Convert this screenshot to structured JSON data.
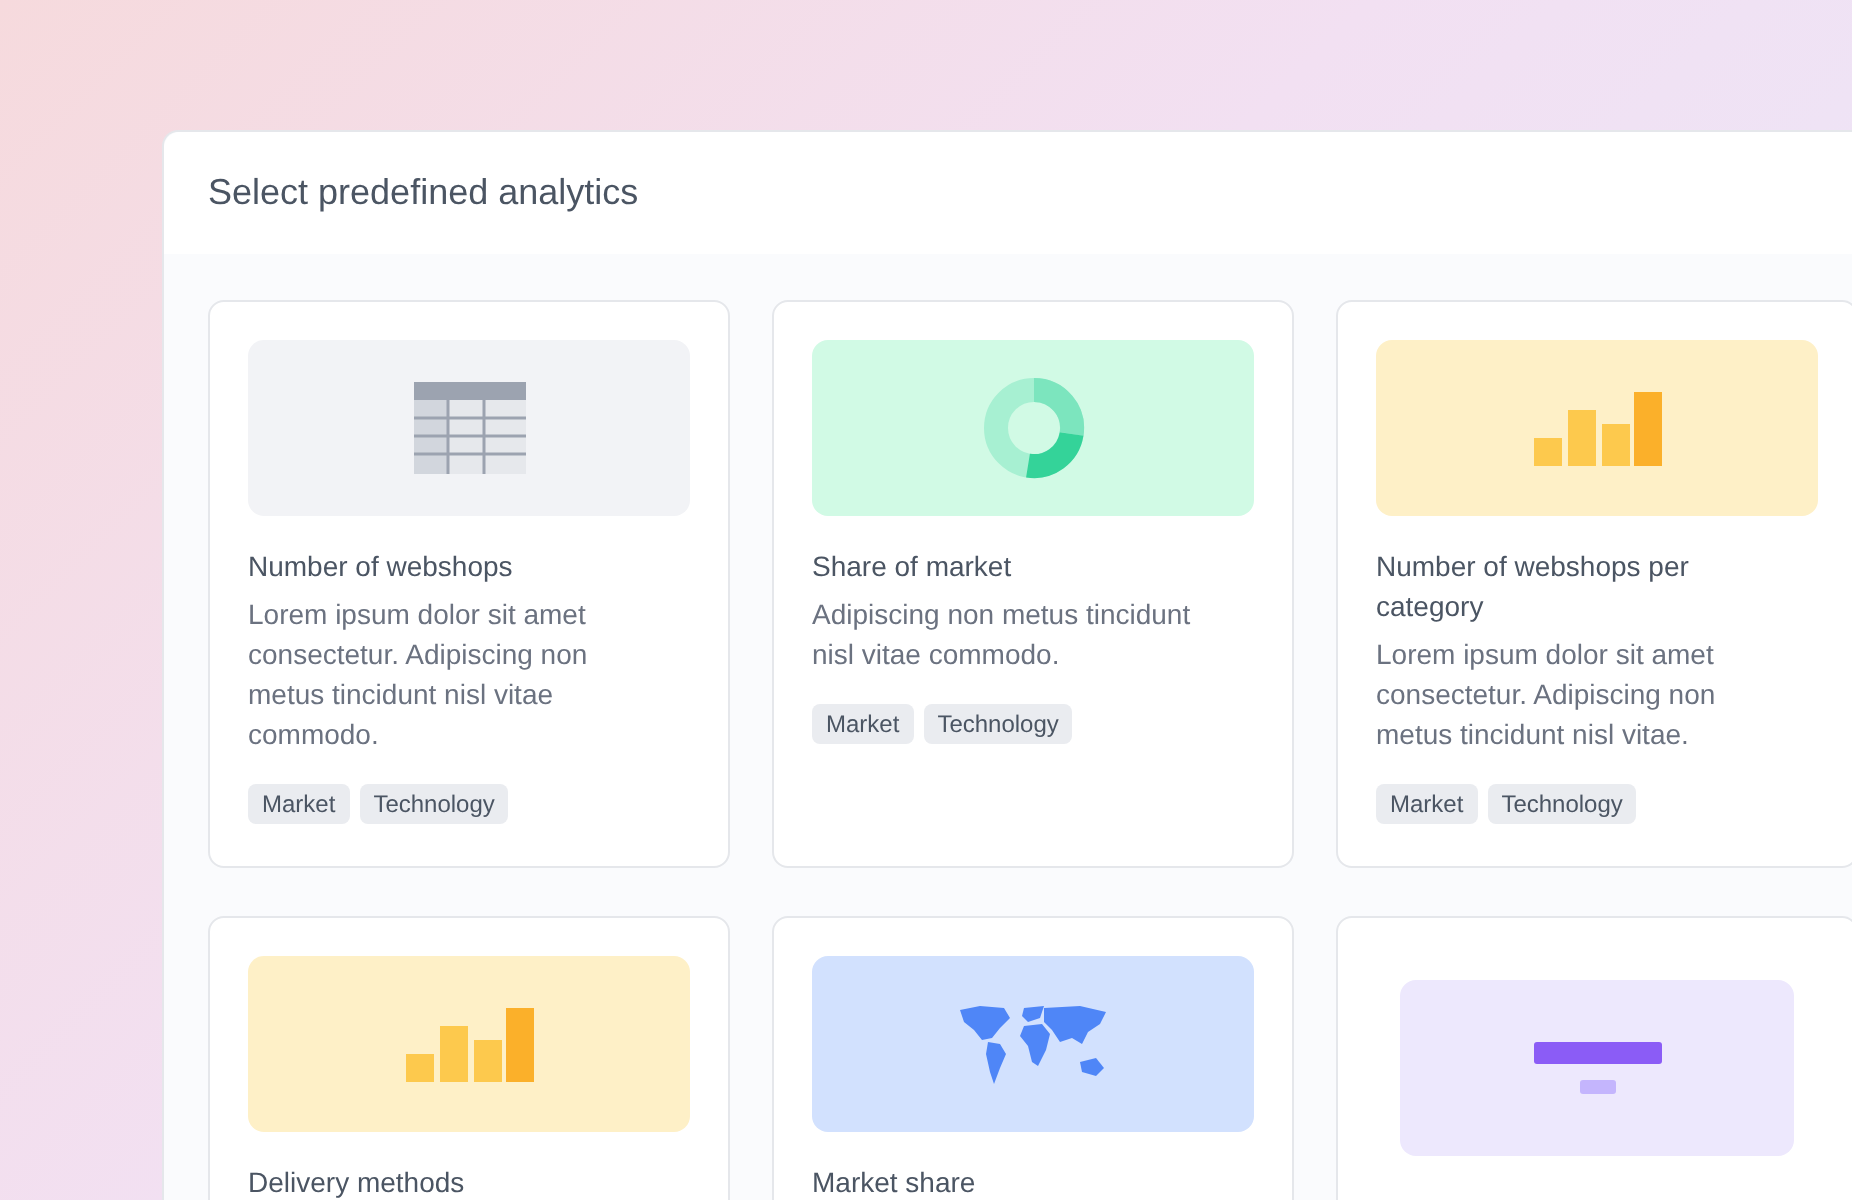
{
  "panel": {
    "title": "Select predefined analytics"
  },
  "cards": [
    {
      "kind": "table",
      "title": "Number of webshops",
      "description": "Lorem ipsum dolor sit amet consectetur. Adipiscing non metus tincidunt nisl vitae commodo.",
      "tags": [
        "Market",
        "Technology"
      ]
    },
    {
      "kind": "donut",
      "title": "Share of market",
      "description": "Adipiscing non metus tincidunt nisl vitae commodo.",
      "tags": [
        "Market",
        "Technology"
      ]
    },
    {
      "kind": "bars",
      "title": "Number of webshops per category",
      "description": "Lorem ipsum dolor sit amet consectetur. Adipiscing non metus tincidunt nisl vitae.",
      "tags": [
        "Market",
        "Technology"
      ]
    },
    {
      "kind": "bars",
      "title": "Delivery methods"
    },
    {
      "kind": "map",
      "title": "Market share"
    },
    {
      "kind": "banner"
    }
  ]
}
